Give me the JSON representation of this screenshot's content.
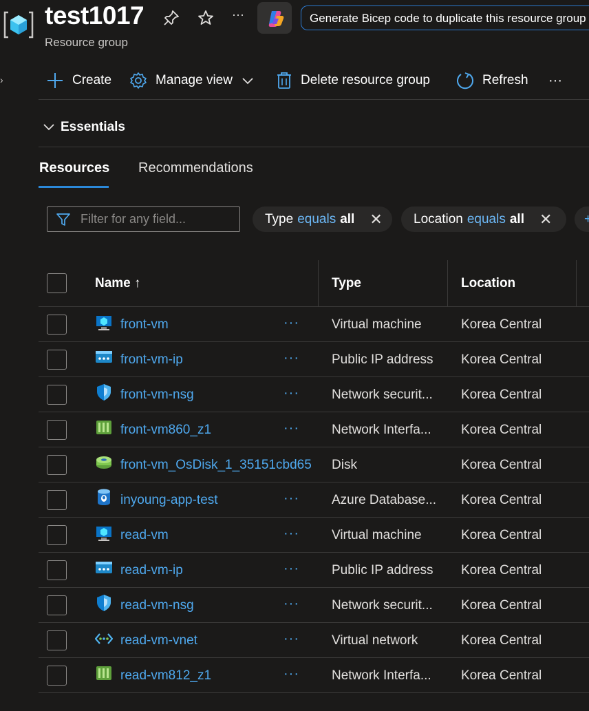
{
  "header": {
    "title": "test1017",
    "subtitle": "Resource group",
    "copilot_prompt": "Generate Bicep code to duplicate this resource group",
    "icons": [
      "resource-group-icon",
      "pin-icon",
      "star-icon",
      "more-icon",
      "copilot-icon"
    ]
  },
  "toolbar": {
    "create": "Create",
    "manage_view": "Manage view",
    "delete": "Delete resource group",
    "refresh": "Refresh",
    "more": "···"
  },
  "essentials": {
    "label": "Essentials"
  },
  "tabs": {
    "resources": "Resources",
    "recommendations": "Recommendations"
  },
  "filter": {
    "placeholder": "Filter for any field...",
    "type_pill": {
      "field": "Type",
      "op": "equals",
      "value": "all"
    },
    "location_pill": {
      "field": "Location",
      "op": "equals",
      "value": "all"
    }
  },
  "table": {
    "columns": {
      "name": "Name ↑",
      "type": "Type",
      "location": "Location"
    },
    "rows": [
      {
        "name": "front-vm",
        "type": "Virtual machine",
        "location": "Korea Central",
        "icon": "vm-icon",
        "more": "···"
      },
      {
        "name": "front-vm-ip",
        "type": "Public IP address",
        "location": "Korea Central",
        "icon": "public-ip-icon",
        "more": "···"
      },
      {
        "name": "front-vm-nsg",
        "type": "Network securit...",
        "location": "Korea Central",
        "icon": "nsg-shield-icon",
        "more": "···"
      },
      {
        "name": "front-vm860_z1",
        "type": "Network Interfa...",
        "location": "Korea Central",
        "icon": "nic-icon",
        "more": "···"
      },
      {
        "name": "front-vm_OsDisk_1_35151cbd65",
        "type": "Disk",
        "location": "Korea Central",
        "icon": "disk-icon",
        "more": ""
      },
      {
        "name": "inyoung-app-test",
        "type": "Azure Database...",
        "location": "Korea Central",
        "icon": "postgres-db-icon",
        "more": "···"
      },
      {
        "name": "read-vm",
        "type": "Virtual machine",
        "location": "Korea Central",
        "icon": "vm-icon",
        "more": "···"
      },
      {
        "name": "read-vm-ip",
        "type": "Public IP address",
        "location": "Korea Central",
        "icon": "public-ip-icon",
        "more": "···"
      },
      {
        "name": "read-vm-nsg",
        "type": "Network securit...",
        "location": "Korea Central",
        "icon": "nsg-shield-icon",
        "more": "···"
      },
      {
        "name": "read-vm-vnet",
        "type": "Virtual network",
        "location": "Korea Central",
        "icon": "vnet-icon",
        "more": "···"
      },
      {
        "name": "read-vm812_z1",
        "type": "Network Interfa...",
        "location": "Korea Central",
        "icon": "nic-icon",
        "more": "···"
      }
    ]
  },
  "colors": {
    "accent": "#2b88d8",
    "link": "#4fa9ef",
    "background": "#1b1a19"
  }
}
